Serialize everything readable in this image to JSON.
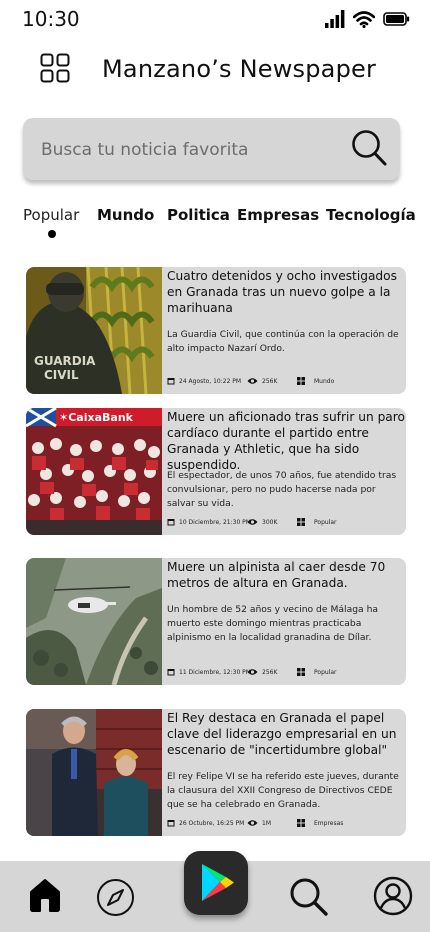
{
  "status_bar": {
    "time": "10:30"
  },
  "header": {
    "title": "Manzano’s Newspaper"
  },
  "search": {
    "placeholder": "Busca tu noticia favorita"
  },
  "tabs": [
    {
      "label": "Popular",
      "active": true
    },
    {
      "label": "Mundo"
    },
    {
      "label": "Politica"
    },
    {
      "label": "Empresas"
    },
    {
      "label": "Tecnología"
    }
  ],
  "articles": [
    {
      "title": "Cuatro detenidos y ocho investigados en Granada tras un nuevo golpe a la marihuana",
      "description": "La Guardia Civil, que continúa con la operación de alto impacto Nazarí Ordo.",
      "date": "24 Agosto, 10:22 PM",
      "views": "256K",
      "category": "Mundo",
      "image_text": "GUARDIA CIVIL"
    },
    {
      "title": "Muere un aficionado tras sufrir un paro cardíaco durante el partido entre Granada y Athletic, que ha sido suspendido.",
      "description": "El espectador, de unos 70 años, fue atendido tras convulsionar, pero no pudo hacerse nada por salvar su vida.",
      "date": "10 Diciembre, 21:30 PM",
      "views": "300K",
      "category": "Popular",
      "image_text": "CaixaBank"
    },
    {
      "title": "Muere un alpinista al caer desde 70 metros de altura en Granada.",
      "description": "Un hombre de 52 años y vecino de Málaga ha muerto este domingo mientras practicaba alpinismo en la localidad granadina de Dílar.",
      "date": "11 Diciembre, 12:30 PM",
      "views": "256K",
      "category": "Popular"
    },
    {
      "title": "El Rey destaca en Granada el papel clave del liderazgo empresarial en un escenario de \"incertidumbre global\"",
      "description": "El rey Felipe VI se ha referido este jueves, durante la clausura del XXII Congreso de Directivos CEDE que se ha celebrado en Granada.",
      "date": "26 Octubre, 16:25 PM",
      "views": "1M",
      "category": "Empresas"
    }
  ],
  "icons": {
    "menu": "grid-icon",
    "search": "search-icon",
    "calendar": "calendar-icon",
    "views": "eye-icon",
    "category": "grid-small-icon",
    "home": "home-icon",
    "explore": "compass-icon",
    "play": "play-icon",
    "profile": "user-icon"
  },
  "colors": {
    "card_bg": "#d9d9d9",
    "bar_bg": "#d6d6d6",
    "play_bg": "#2a2a2a"
  }
}
